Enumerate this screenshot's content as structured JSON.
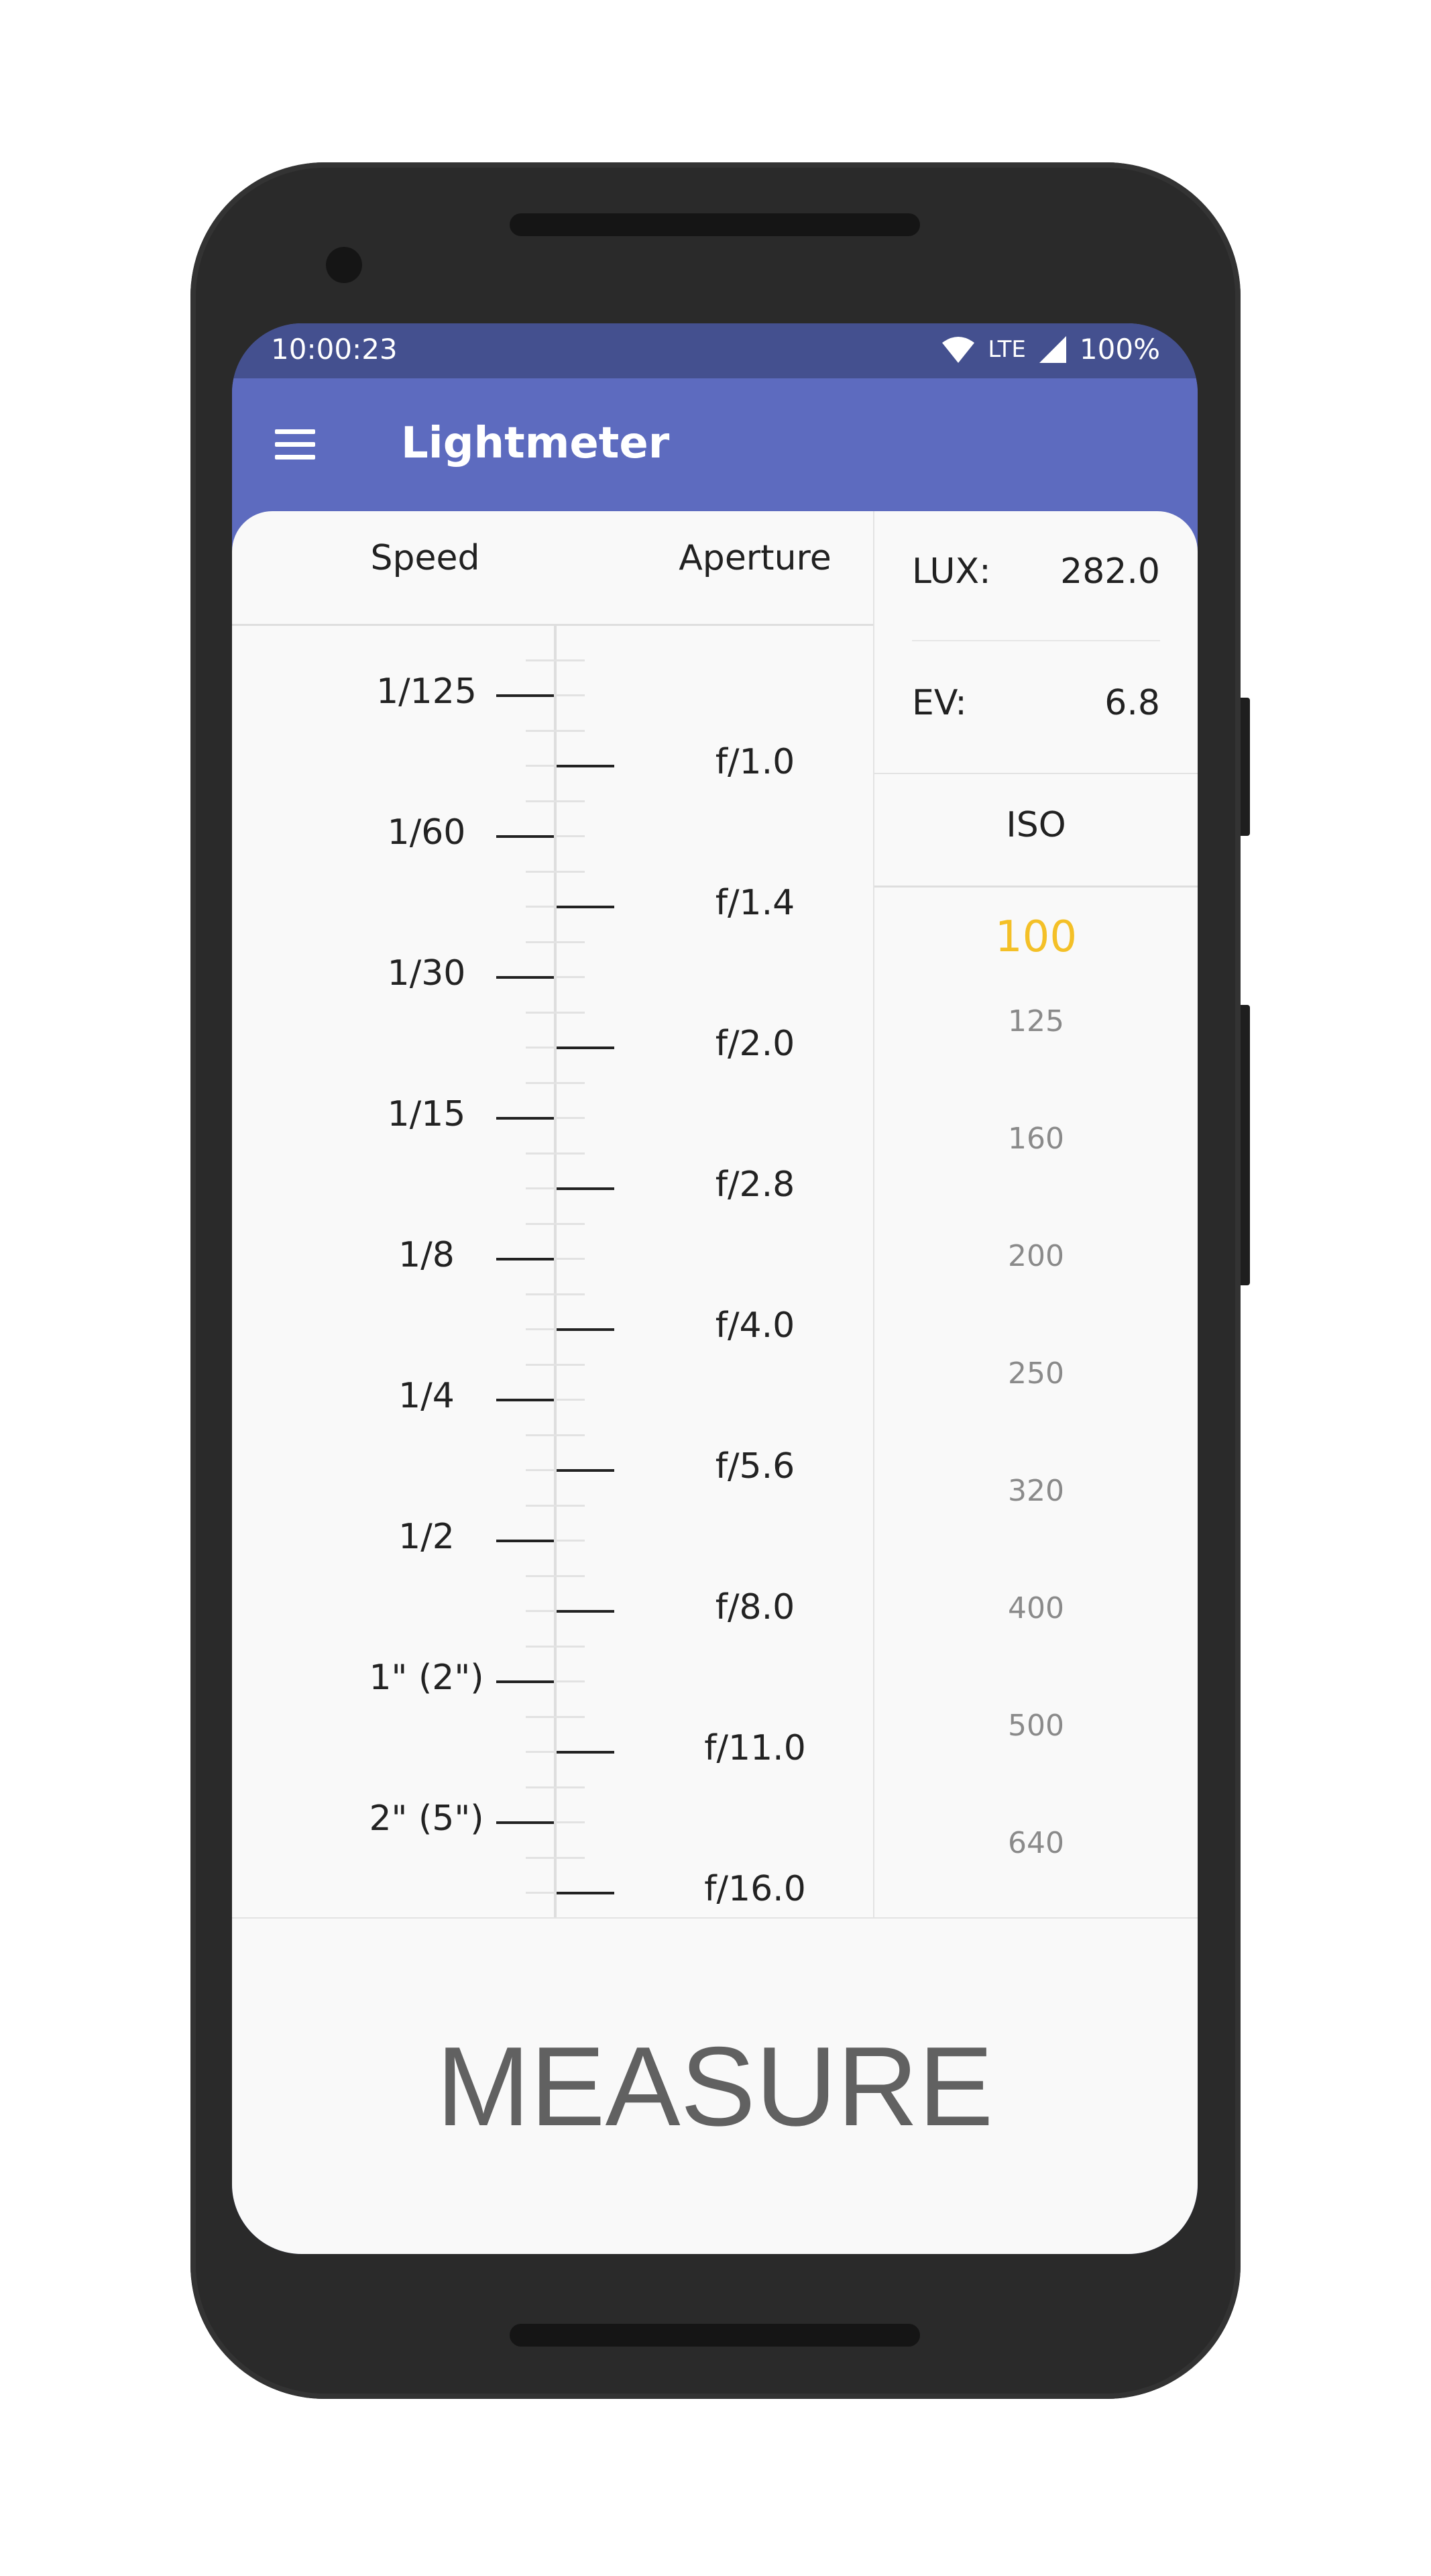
{
  "status": {
    "time": "10:00:23",
    "network": "LTE",
    "battery": "100%"
  },
  "appbar": {
    "title": "Lightmeter"
  },
  "columns": {
    "speed": "Speed",
    "aperture": "Aperture"
  },
  "speeds": [
    "1/125",
    "1/60",
    "1/30",
    "1/15",
    "1/8",
    "1/4",
    "1/2",
    "1\" (2\")",
    "2\" (5\")"
  ],
  "apertures": [
    "f/1.0",
    "f/1.4",
    "f/2.0",
    "f/2.8",
    "f/4.0",
    "f/5.6",
    "f/8.0",
    "f/11.0",
    "f/16.0"
  ],
  "readings": {
    "lux_label": "LUX:",
    "lux_value": "282.0",
    "ev_label": "EV:",
    "ev_value": "6.8"
  },
  "iso": {
    "title": "ISO",
    "selected": "100",
    "values": [
      "100",
      "125",
      "160",
      "200",
      "250",
      "320",
      "400",
      "500",
      "640"
    ]
  },
  "measure_label": "MEASURE",
  "colors": {
    "appbar": "#5d6bbf",
    "statusbar": "#44508f",
    "iso_selected": "#f4c027"
  }
}
